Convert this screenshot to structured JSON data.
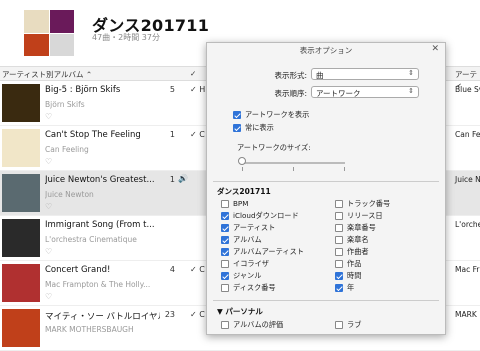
{
  "playlist": {
    "title": "ダンス201711",
    "subtitle": "47曲・2時間 37分"
  },
  "columns": {
    "album_by_artist": "アーティスト別アルバム ⌃",
    "right_header": "アーティ"
  },
  "colors": {
    "accent": "#2f73d8",
    "selected_row": "#e6e6e6"
  },
  "rows": [
    {
      "title": "Big-5 : Björn Skifs",
      "artist": "Björn Skifs",
      "num": "5",
      "check": "✓ H",
      "right": "Blue Sv",
      "art_color": "#3a2a10"
    },
    {
      "title": "Can't Stop The Feeling",
      "artist": "Can Feeling",
      "num": "1",
      "check": "✓ C",
      "right": "Can Fe",
      "art_color": "#f1e6c8"
    },
    {
      "title": "Juice Newton's Greatest...",
      "artist": "Juice Newton",
      "num": "1",
      "check": "",
      "right": "Juice N",
      "art_color": "#5a6a70"
    },
    {
      "title": "Immigrant Song (From t...",
      "artist": "L'orchestra Cinematique",
      "num": "",
      "check": "",
      "right": "L'orche",
      "art_color": "#2a2a2a"
    },
    {
      "title": "Concert Grand!",
      "artist": "Mac Frampton & The Holly...",
      "num": "4",
      "check": "✓ C",
      "right": "Mac Fr",
      "art_color": "#b03030"
    },
    {
      "title": "マイティ・ソー バトルロイヤル...",
      "artist": "MARK MOTHERSBAUGH",
      "num": "23",
      "check": "✓ C",
      "right": "MARK",
      "art_color": "#c0401a"
    }
  ],
  "dialog": {
    "title": "表示オプション",
    "close": "✕",
    "format_label": "表示形式:",
    "format_value": "曲",
    "order_label": "表示順序:",
    "order_value": "アートワーク",
    "show_artwork": "アートワークを表示",
    "always_show": "常に表示",
    "artwork_size": "アートワークのサイズ:",
    "section_title": "ダンス201711",
    "left_options": [
      {
        "label": "BPM",
        "on": false
      },
      {
        "label": "iCloudダウンロード",
        "on": true
      },
      {
        "label": "アーティスト",
        "on": true
      },
      {
        "label": "アルバム",
        "on": true
      },
      {
        "label": "アルバムアーティスト",
        "on": true
      },
      {
        "label": "イコライザ",
        "on": false
      },
      {
        "label": "ジャンル",
        "on": true
      },
      {
        "label": "ディスク番号",
        "on": false
      }
    ],
    "right_options": [
      {
        "label": "トラック番号",
        "on": false
      },
      {
        "label": "リリース日",
        "on": false
      },
      {
        "label": "楽章番号",
        "on": false
      },
      {
        "label": "楽章名",
        "on": false
      },
      {
        "label": "作曲者",
        "on": false
      },
      {
        "label": "作品",
        "on": false
      },
      {
        "label": "時間",
        "on": true
      },
      {
        "label": "年",
        "on": true
      }
    ],
    "personal_section": "パーソナル",
    "personal_options": [
      {
        "label": "アルバムの評価",
        "on": false
      },
      {
        "label": "ラブ",
        "on": false
      }
    ]
  }
}
